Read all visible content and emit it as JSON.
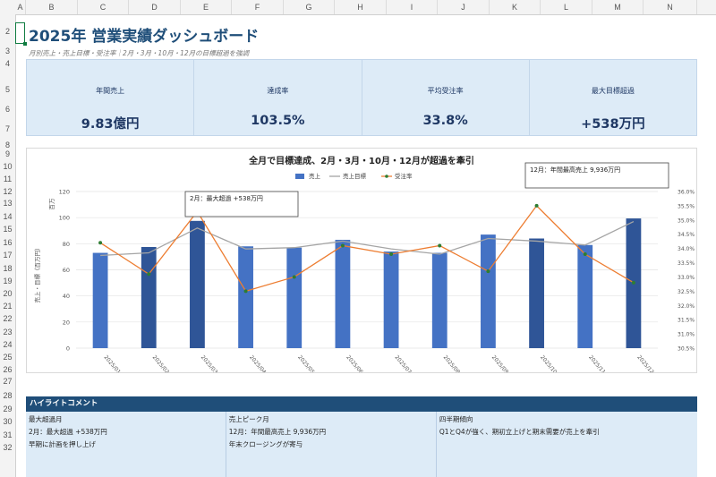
{
  "sheet": {
    "columns": [
      "A",
      "B",
      "C",
      "D",
      "E",
      "F",
      "G",
      "H",
      "I",
      "J",
      "K",
      "L",
      "M",
      "N"
    ],
    "rows": [
      "2",
      "3",
      "4",
      "5",
      "6",
      "7",
      "8",
      "9",
      "10",
      "11",
      "12",
      "13",
      "14",
      "15",
      "16",
      "17",
      "18",
      "19",
      "20",
      "21",
      "22",
      "23",
      "24",
      "25",
      "26",
      "27",
      "28",
      "29",
      "30",
      "31",
      "32"
    ]
  },
  "header": {
    "title": "2025年 営業実績ダッシュボード",
    "subtitle": "月別売上・売上目標・受注率｜2月・3月・10月・12月の目標超過を強調"
  },
  "kpis": [
    {
      "label": "年間売上",
      "value": "9.83億円"
    },
    {
      "label": "達成率",
      "value": "103.5%"
    },
    {
      "label": "平均受注率",
      "value": "33.8%"
    },
    {
      "label": "最大目標超過",
      "value": "+538万円"
    }
  ],
  "chart_data": {
    "type": "bar",
    "title": "全月で目標達成、2月・3月・10月・12月が超過を牽引",
    "categories": [
      "2025/01",
      "2025/02",
      "2025/03",
      "2025/04",
      "2025/05",
      "2025/06",
      "2025/07",
      "2025/08",
      "2025/09",
      "2025/10",
      "2025/11",
      "2025/12"
    ],
    "series": [
      {
        "name": "売上",
        "type": "bar",
        "values": [
          73,
          77.5,
          97.5,
          78,
          77,
          83,
          74,
          73,
          87,
          84,
          79,
          99.36
        ],
        "color": "#4472c4",
        "highlight_color": "#2f5597",
        "highlight": [
          1,
          2,
          9,
          11
        ]
      },
      {
        "name": "売上目標",
        "type": "line",
        "values": [
          71,
          73,
          92,
          76,
          77,
          82,
          76,
          72,
          84,
          82,
          79,
          97
        ],
        "color": "#a5a5a5"
      },
      {
        "name": "受注率",
        "type": "line",
        "axis": "right",
        "values": [
          34.2,
          33.1,
          35.3,
          32.5,
          33.0,
          34.1,
          33.8,
          34.1,
          33.2,
          35.5,
          33.8,
          32.8
        ],
        "color": "#ed7d31",
        "marker_color": "#2e7d32"
      }
    ],
    "y_left": {
      "label": "売上・目標（百万円）",
      "unit": "百万",
      "lim": [
        0,
        120
      ],
      "ticks": [
        "0",
        "20",
        "40",
        "60",
        "80",
        "100",
        "120"
      ]
    },
    "y_right": {
      "lim": [
        30.5,
        36.0
      ],
      "ticks": [
        "30.5%",
        "31.0%",
        "31.5%",
        "32.0%",
        "32.5%",
        "33.0%",
        "33.5%",
        "34.0%",
        "34.5%",
        "35.0%",
        "35.5%",
        "36.0%"
      ]
    },
    "legend": "top",
    "annotations": [
      {
        "text": "2月：最大超過 +538万円"
      },
      {
        "text": "12月：年間最高売上 9,936万円"
      }
    ]
  },
  "highlights": {
    "title": "ハイライトコメント",
    "columns": [
      {
        "lines": [
          "最大超過月",
          "2月：最大超過 +538万円",
          "早期に計画を押し上げ"
        ]
      },
      {
        "lines": [
          "売上ピーク月",
          "12月：年間最高売上 9,936万円",
          "年末クロージングが寄与"
        ]
      },
      {
        "lines": [
          "四半期傾向",
          "Q1とQ4が強く、期初立上げと期末需要が売上を牽引"
        ]
      }
    ]
  }
}
